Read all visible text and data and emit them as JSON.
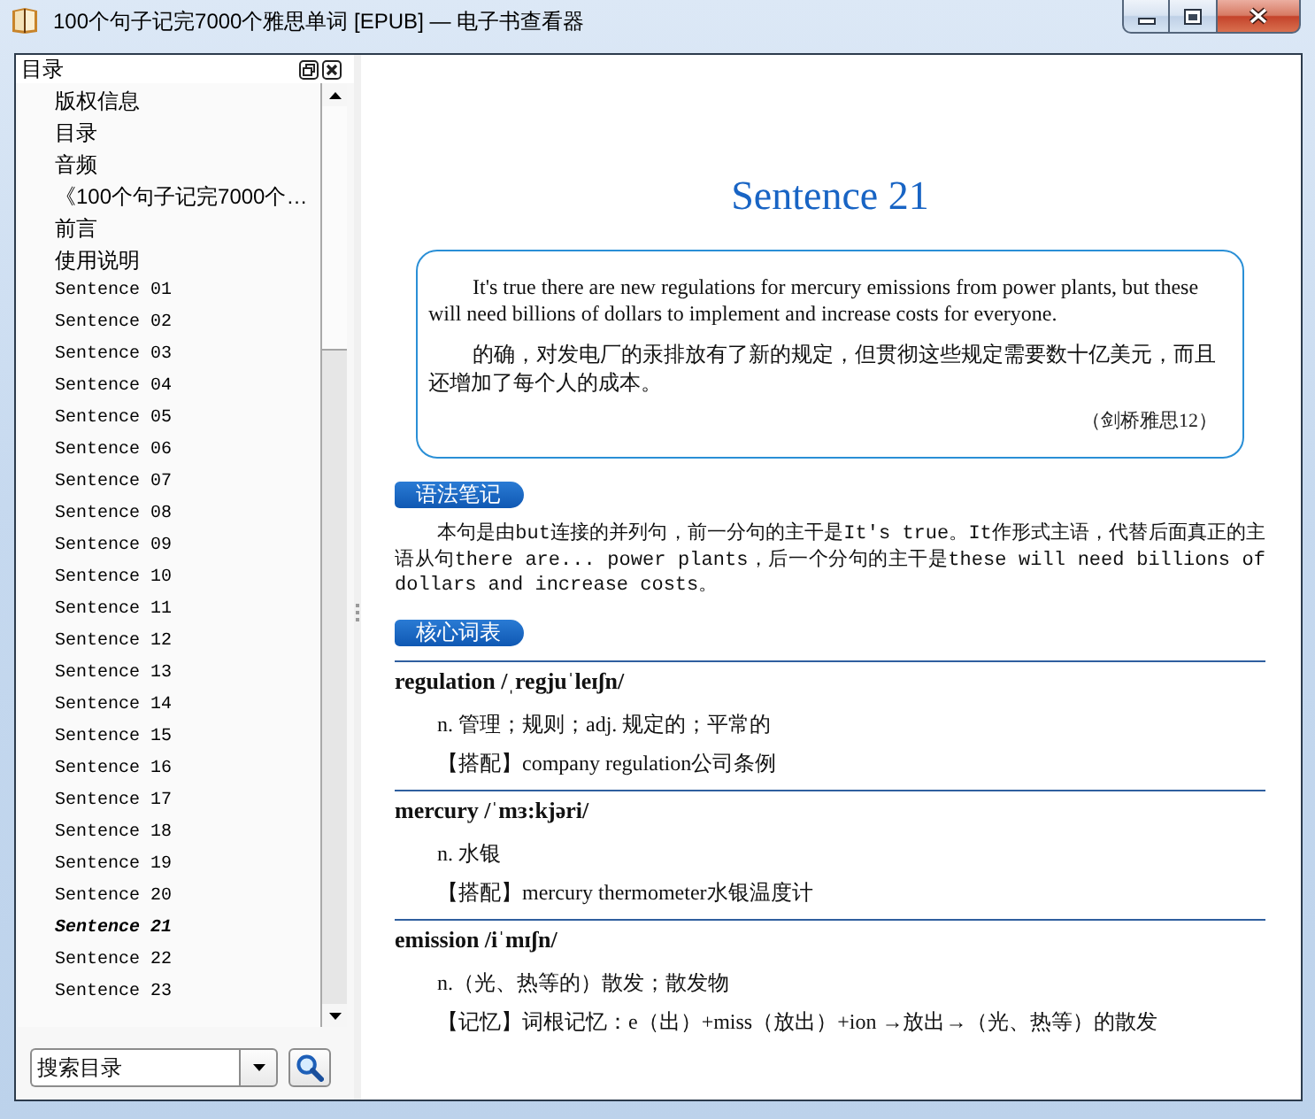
{
  "window": {
    "title": "100个句子记完7000个雅思单词 [EPUB] — 电子书查看器"
  },
  "toc": {
    "title": "目录",
    "items": [
      {
        "label": "版权信息",
        "kind": "front",
        "selected": false
      },
      {
        "label": "目录",
        "kind": "front",
        "selected": false
      },
      {
        "label": "音频",
        "kind": "front",
        "selected": false
      },
      {
        "label": "《100个句子记完7000个…",
        "kind": "front",
        "selected": false
      },
      {
        "label": "前言",
        "kind": "front",
        "selected": false
      },
      {
        "label": "使用说明",
        "kind": "front",
        "selected": false
      },
      {
        "label": "Sentence 01",
        "kind": "sentence",
        "selected": false
      },
      {
        "label": "Sentence 02",
        "kind": "sentence",
        "selected": false
      },
      {
        "label": "Sentence 03",
        "kind": "sentence",
        "selected": false
      },
      {
        "label": "Sentence 04",
        "kind": "sentence",
        "selected": false
      },
      {
        "label": "Sentence 05",
        "kind": "sentence",
        "selected": false
      },
      {
        "label": "Sentence 06",
        "kind": "sentence",
        "selected": false
      },
      {
        "label": "Sentence 07",
        "kind": "sentence",
        "selected": false
      },
      {
        "label": "Sentence 08",
        "kind": "sentence",
        "selected": false
      },
      {
        "label": "Sentence 09",
        "kind": "sentence",
        "selected": false
      },
      {
        "label": "Sentence 10",
        "kind": "sentence",
        "selected": false
      },
      {
        "label": "Sentence 11",
        "kind": "sentence",
        "selected": false
      },
      {
        "label": "Sentence 12",
        "kind": "sentence",
        "selected": false
      },
      {
        "label": "Sentence 13",
        "kind": "sentence",
        "selected": false
      },
      {
        "label": "Sentence 14",
        "kind": "sentence",
        "selected": false
      },
      {
        "label": "Sentence 15",
        "kind": "sentence",
        "selected": false
      },
      {
        "label": "Sentence 16",
        "kind": "sentence",
        "selected": false
      },
      {
        "label": "Sentence 17",
        "kind": "sentence",
        "selected": false
      },
      {
        "label": "Sentence 18",
        "kind": "sentence",
        "selected": false
      },
      {
        "label": "Sentence 19",
        "kind": "sentence",
        "selected": false
      },
      {
        "label": "Sentence 20",
        "kind": "sentence",
        "selected": false
      },
      {
        "label": "Sentence 21",
        "kind": "sentence",
        "selected": true
      },
      {
        "label": "Sentence 22",
        "kind": "sentence",
        "selected": false
      },
      {
        "label": "Sentence 23",
        "kind": "sentence",
        "selected": false
      }
    ],
    "search": {
      "value": "搜索目录"
    }
  },
  "page": {
    "heading": "Sentence 21",
    "sentence": {
      "english": "It's true there are new regulations for mercury emissions from power plants, but these will need billions of dollars to implement and increase costs for everyone.",
      "chinese": "的确，对发电厂的汞排放有了新的规定，但贯彻这些规定需要数十亿美元，而且还增加了每个人的成本。",
      "source": "（剑桥雅思12）"
    },
    "grammar": {
      "tag": "语法笔记",
      "text": "本句是由but连接的并列句，前一分句的主干是It's true。It作形式主语，代替后面真正的主语从句there are... power plants，后一个分句的主干是these will need billions of dollars and increase costs。"
    },
    "vocabulary": {
      "tag": "核心词表",
      "entries": [
        {
          "headword": "regulation /ˌregjuˈleɪʃn/",
          "definition": "n. 管理；规则；adj. 规定的；平常的",
          "note": "【搭配】company regulation公司条例"
        },
        {
          "headword": "mercury /ˈmɜ:kjəri/",
          "definition": "n. 水银",
          "note": "【搭配】mercury thermometer水银温度计"
        },
        {
          "headword": "emission /iˈmɪʃn/",
          "definition": "n.（光、热等的）散发；散发物",
          "note": "【记忆】词根记忆：e（出）+miss（放出）+ion →放出→（光、热等）的散发"
        }
      ]
    }
  }
}
